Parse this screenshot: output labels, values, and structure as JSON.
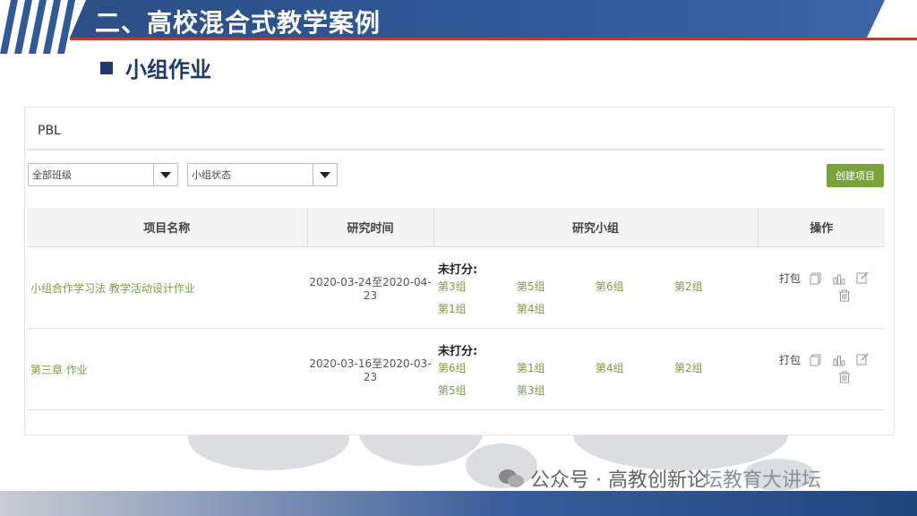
{
  "slide": {
    "title": "二、高校混合式教学案例",
    "subtitle": "小组作业"
  },
  "app": {
    "section": "PBL",
    "filters": {
      "class": "全部班级",
      "status": "小组状态"
    },
    "create_button": "创建项目",
    "columns": [
      "项目名称",
      "研究时间",
      "研究小组",
      "操作"
    ],
    "rows": [
      {
        "name": "小组合作学习法 教学活动设计作业",
        "time": "2020-03-24至2020-04-23",
        "group_label": "未打分:",
        "groups": [
          "第3组",
          "第5组",
          "第6组",
          "第2组",
          "第1组",
          "第4组"
        ],
        "pack": "打包"
      },
      {
        "name": "第三章 作业",
        "time": "2020-03-16至2020-03-23",
        "group_label": "未打分:",
        "groups": [
          "第6组",
          "第1组",
          "第4组",
          "第2组",
          "第5组",
          "第3组"
        ],
        "pack": "打包"
      }
    ]
  },
  "watermark": {
    "text": "公众号 · 高教创新论",
    "text2": "坛教育大讲坛"
  },
  "colors": {
    "banner": "#2f5a98",
    "accent_green": "#7aa33a",
    "link_green": "#7d9a4a",
    "red_rule": "#c0392b"
  },
  "icons": [
    "copy-icon",
    "bar-chart-icon",
    "edit-icon",
    "trash-icon",
    "wechat-icon"
  ]
}
